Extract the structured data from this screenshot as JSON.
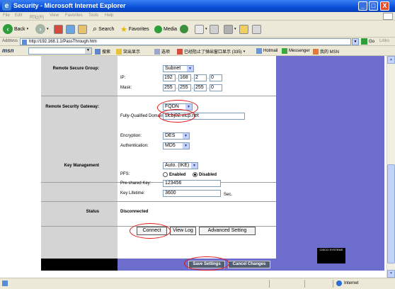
{
  "window": {
    "title": "Security - Microsoft Internet Explorer",
    "minimize": "_",
    "maximize": "□",
    "close": "X"
  },
  "menu": {
    "items": [
      "File",
      "Edit",
      "阿址(R)",
      "View",
      "Favorites",
      "Tools",
      "Help"
    ]
  },
  "toolbar": {
    "back": "Back",
    "search": "Search",
    "favorites": "Favorites",
    "media": "Media"
  },
  "address": {
    "label": "Address",
    "url": "http://192.168.1.1/PassThrough.htm",
    "go": "Go",
    "links": "Links"
  },
  "msn": {
    "brand": "msn",
    "search": "搜索",
    "highlight": "突出显示",
    "options": "选项",
    "popup": "已经阻止了弹出窗口显示 (335)",
    "hotmail": "Hotmail",
    "messenger": "Messenger",
    "mymsn": "我的 MSN"
  },
  "form": {
    "remote_secure_group": {
      "label": "Remote Secure Group:",
      "type": "Subnet",
      "ip_label": "IP:",
      "ip": [
        "192",
        "168",
        "2",
        "0"
      ],
      "mask_label": "Mask:",
      "mask": [
        "255",
        "255",
        "255",
        "0"
      ]
    },
    "remote_security_gateway": {
      "label": "Remote Security Gateway:",
      "type": "FQDN",
      "fqdn_label": "Fully-Qualified Domain:",
      "fqdn": "slcbj02.vicp.net"
    },
    "encryption": {
      "label": "Encryption:",
      "value": "DES"
    },
    "authentication": {
      "label": "Authentication:",
      "value": "MD5"
    },
    "key_management": {
      "label": "Key Management",
      "mode": "Auto. (IKE)",
      "pfs_label": "PFS:",
      "pfs_enabled": "Enabled",
      "pfs_disabled": "Disabled",
      "psk_label": "Pre-shared Key:",
      "psk": "123456",
      "lifetime_label": "Key Lifetime:",
      "lifetime": "3600",
      "lifetime_unit": "Sec."
    },
    "status": {
      "label": "Status",
      "value": "Disconnected"
    },
    "buttons": {
      "connect": "Connect",
      "view_log": "View Log",
      "advanced": "Advanced Setting"
    },
    "footer": {
      "save": "Save Settings",
      "cancel": "Cancel Changes"
    },
    "brand": "CISCO SYSTEMS"
  },
  "statusbar": {
    "zone": "Internet"
  }
}
